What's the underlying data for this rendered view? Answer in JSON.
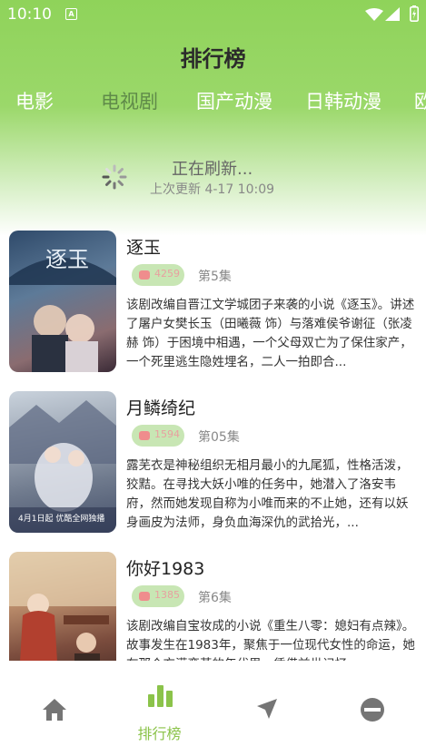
{
  "status_bar": {
    "time": "10:10",
    "a_badge": "A",
    "icons": [
      "wifi-icon",
      "signal-icon",
      "battery-icon"
    ]
  },
  "header": {
    "title": "排行榜"
  },
  "tabs": [
    {
      "label": "电影",
      "active": false
    },
    {
      "label": "电视剧",
      "active": true
    },
    {
      "label": "国产动漫",
      "active": false
    },
    {
      "label": "日韩动漫",
      "active": false
    },
    {
      "label": "欧",
      "active": false
    }
  ],
  "refresh": {
    "title": "正在刷新...",
    "subtitle": "上次更新 4-17 10:09"
  },
  "items": [
    {
      "title": "逐玉",
      "heat": "4259",
      "episode": "第5集",
      "poster_text": "逐玉",
      "description": "该剧改编自晋江文学城团子来袭的小说《逐玉》。讲述了屠户女樊长玉（田曦薇 饰）与落难侯爷谢征（张凌赫 饰）于困境中相遇，一个父母双亡为了保住家产，一个死里逃生隐姓埋名，二人一拍即合..."
    },
    {
      "title": "月鳞绮纪",
      "heat": "1594",
      "episode": "第05集",
      "poster_text": "4月1日起 优酷全网独播",
      "description": "露芜衣是神秘组织无相月最小的九尾狐，性格活泼，狡黠。在寻找大妖小唯的任务中，她潜入了洛安韦府，然而她发现自称为小唯而来的不止她，还有以妖身画皮为法师，身负血海深仇的武拾光，..."
    },
    {
      "title": "你好1983",
      "heat": "1385",
      "episode": "第6集",
      "poster_text": "",
      "description": "该剧改编自宝妆成的小说《重生八零：媳妇有点辣》。故事发生在1983年，聚焦于一位现代女性的命运，她在那个充满变革的年代里，凭借前世记忆..."
    }
  ],
  "bottom_nav": [
    {
      "icon": "home-icon",
      "label": "",
      "active": false
    },
    {
      "icon": "ranking-icon",
      "label": "排行榜",
      "active": true
    },
    {
      "icon": "send-icon",
      "label": "",
      "active": false
    },
    {
      "icon": "profile-icon",
      "label": "",
      "active": false
    }
  ],
  "colors": {
    "accent": "#8bc34a",
    "header_green": "#8fd35a",
    "active_tab": "#5f8a49",
    "inactive_icon": "#757575"
  }
}
